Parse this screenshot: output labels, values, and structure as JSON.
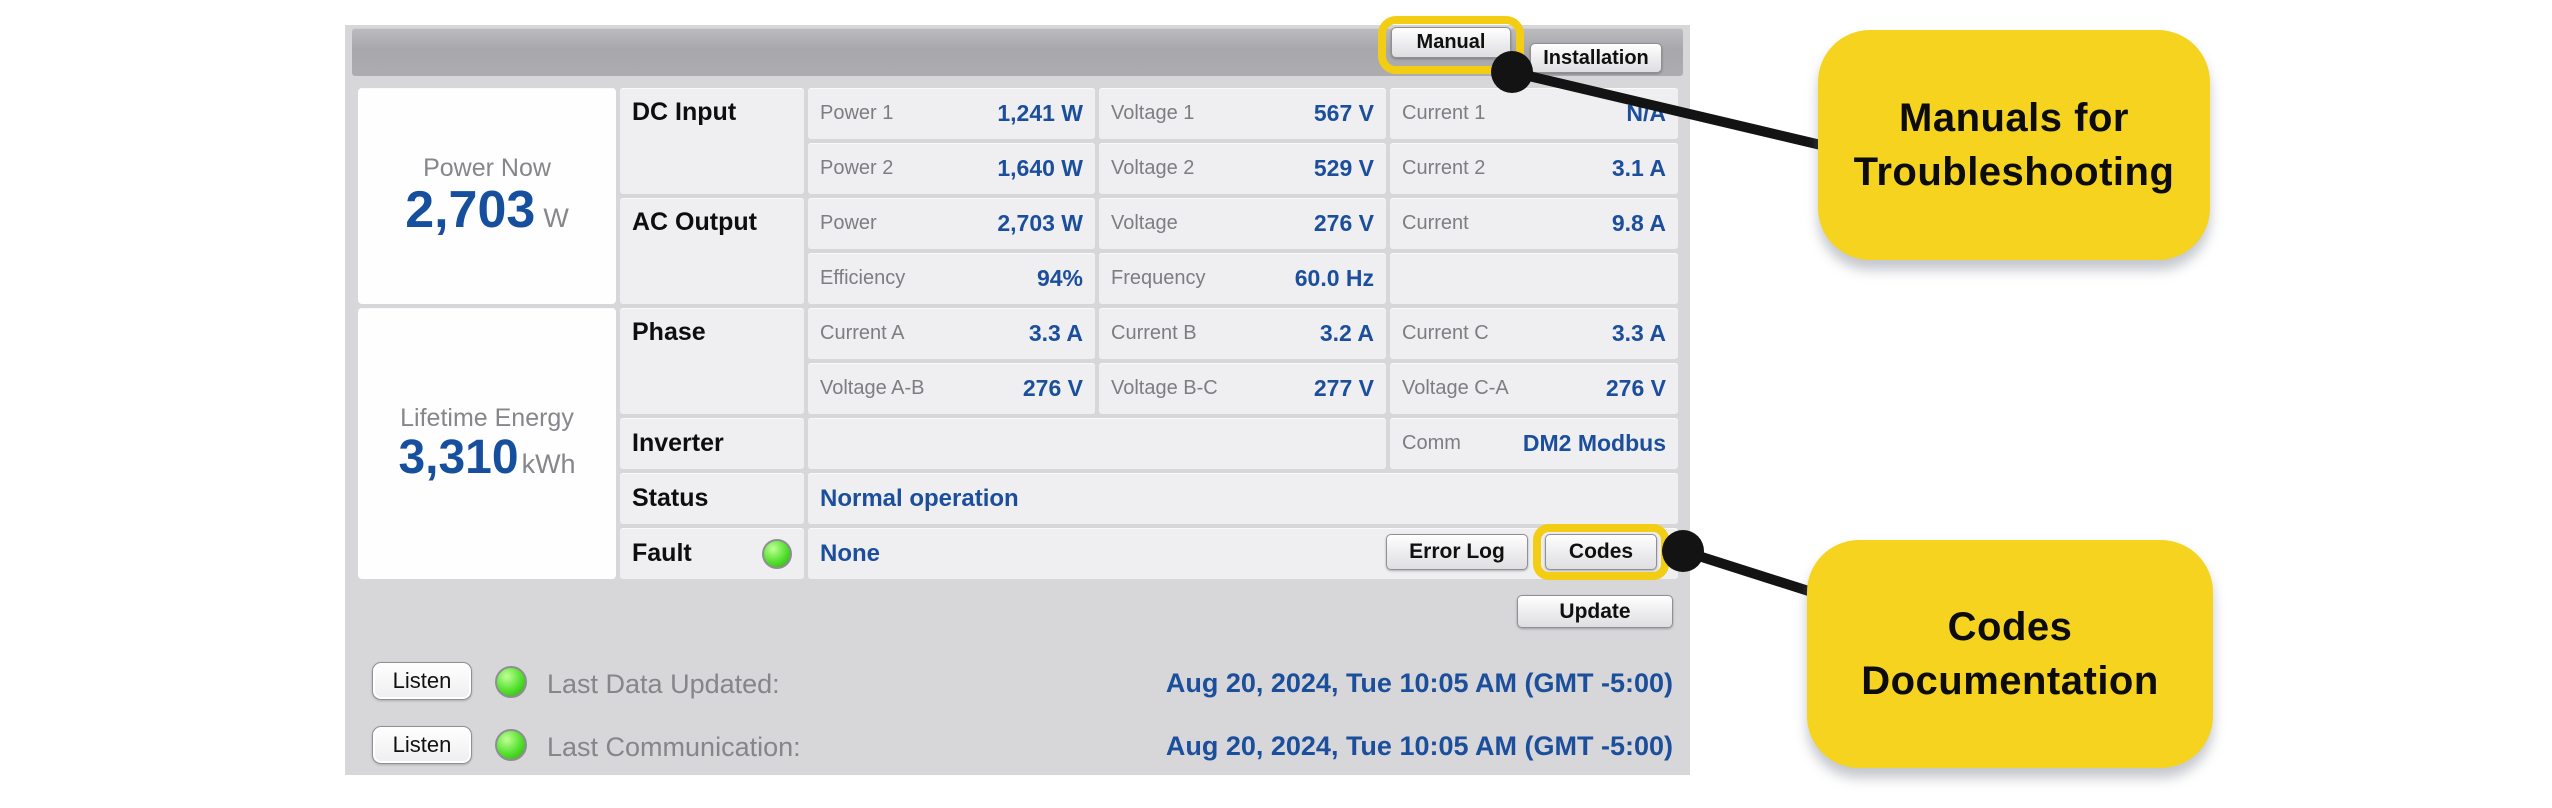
{
  "toolbar": {
    "manual_label": "Manual",
    "installation_label": "Installation"
  },
  "summary": {
    "power_now": {
      "label": "Power Now",
      "value": "2,703",
      "unit": "W"
    },
    "lifetime_energy": {
      "label": "Lifetime Energy",
      "value": "3,310",
      "unit": "kWh"
    }
  },
  "sections": {
    "dc_input": "DC Input",
    "ac_output": "AC Output",
    "phase": "Phase",
    "inverter": "Inverter",
    "status": "Status",
    "fault": "Fault"
  },
  "grid": {
    "rows": [
      {
        "cells": [
          {
            "label": "Power 1",
            "value": "1,241 W"
          },
          {
            "label": "Voltage 1",
            "value": "567 V"
          },
          {
            "label": "Current 1",
            "value": "N/A"
          }
        ]
      },
      {
        "cells": [
          {
            "label": "Power 2",
            "value": "1,640 W"
          },
          {
            "label": "Voltage 2",
            "value": "529 V"
          },
          {
            "label": "Current 2",
            "value": "3.1 A"
          }
        ]
      },
      {
        "cells": [
          {
            "label": "Power",
            "value": "2,703 W"
          },
          {
            "label": "Voltage",
            "value": "276 V"
          },
          {
            "label": "Current",
            "value": "9.8 A"
          }
        ]
      },
      {
        "cells": [
          {
            "label": "Efficiency",
            "value": "94%"
          },
          {
            "label": "Frequency",
            "value": "60.0 Hz"
          }
        ]
      },
      {
        "cells": [
          {
            "label": "Current A",
            "value": "3.3 A"
          },
          {
            "label": "Current B",
            "value": "3.2 A"
          },
          {
            "label": "Current C",
            "value": "3.3 A"
          }
        ]
      },
      {
        "cells": [
          {
            "label": "Voltage A-B",
            "value": "276 V"
          },
          {
            "label": "Voltage B-C",
            "value": "277 V"
          },
          {
            "label": "Voltage C-A",
            "value": "276 V"
          }
        ]
      }
    ]
  },
  "inverter_row": {
    "comm_label": "Comm",
    "comm_value": "DM2 Modbus"
  },
  "status_row": {
    "value": "Normal operation"
  },
  "fault_row": {
    "value": "None",
    "error_log_label": "Error Log",
    "codes_label": "Codes"
  },
  "footer": {
    "update_label": "Update",
    "listen_label": "Listen",
    "last_data_label": "Last Data Updated:",
    "last_data_value": "Aug 20, 2024, Tue 10:05 AM (GMT -5:00)",
    "last_comm_label": "Last Communication:",
    "last_comm_value": "Aug 20, 2024, Tue 10:05 AM (GMT -5:00)"
  },
  "annotations": {
    "manual_note_line1": "Manuals for",
    "manual_note_line2": "Troubleshooting",
    "codes_note_line1": "Codes",
    "codes_note_line2": "Documentation"
  },
  "icons": {
    "fault_led": "green-status-led",
    "last_data_led": "green-status-led",
    "last_comm_led": "green-status-led"
  },
  "colors": {
    "accent_yellow": "#f5d31f",
    "value_blue": "#1b4f9c",
    "led_green": "#52e02c",
    "panel_gray": "#d7d6d9"
  }
}
